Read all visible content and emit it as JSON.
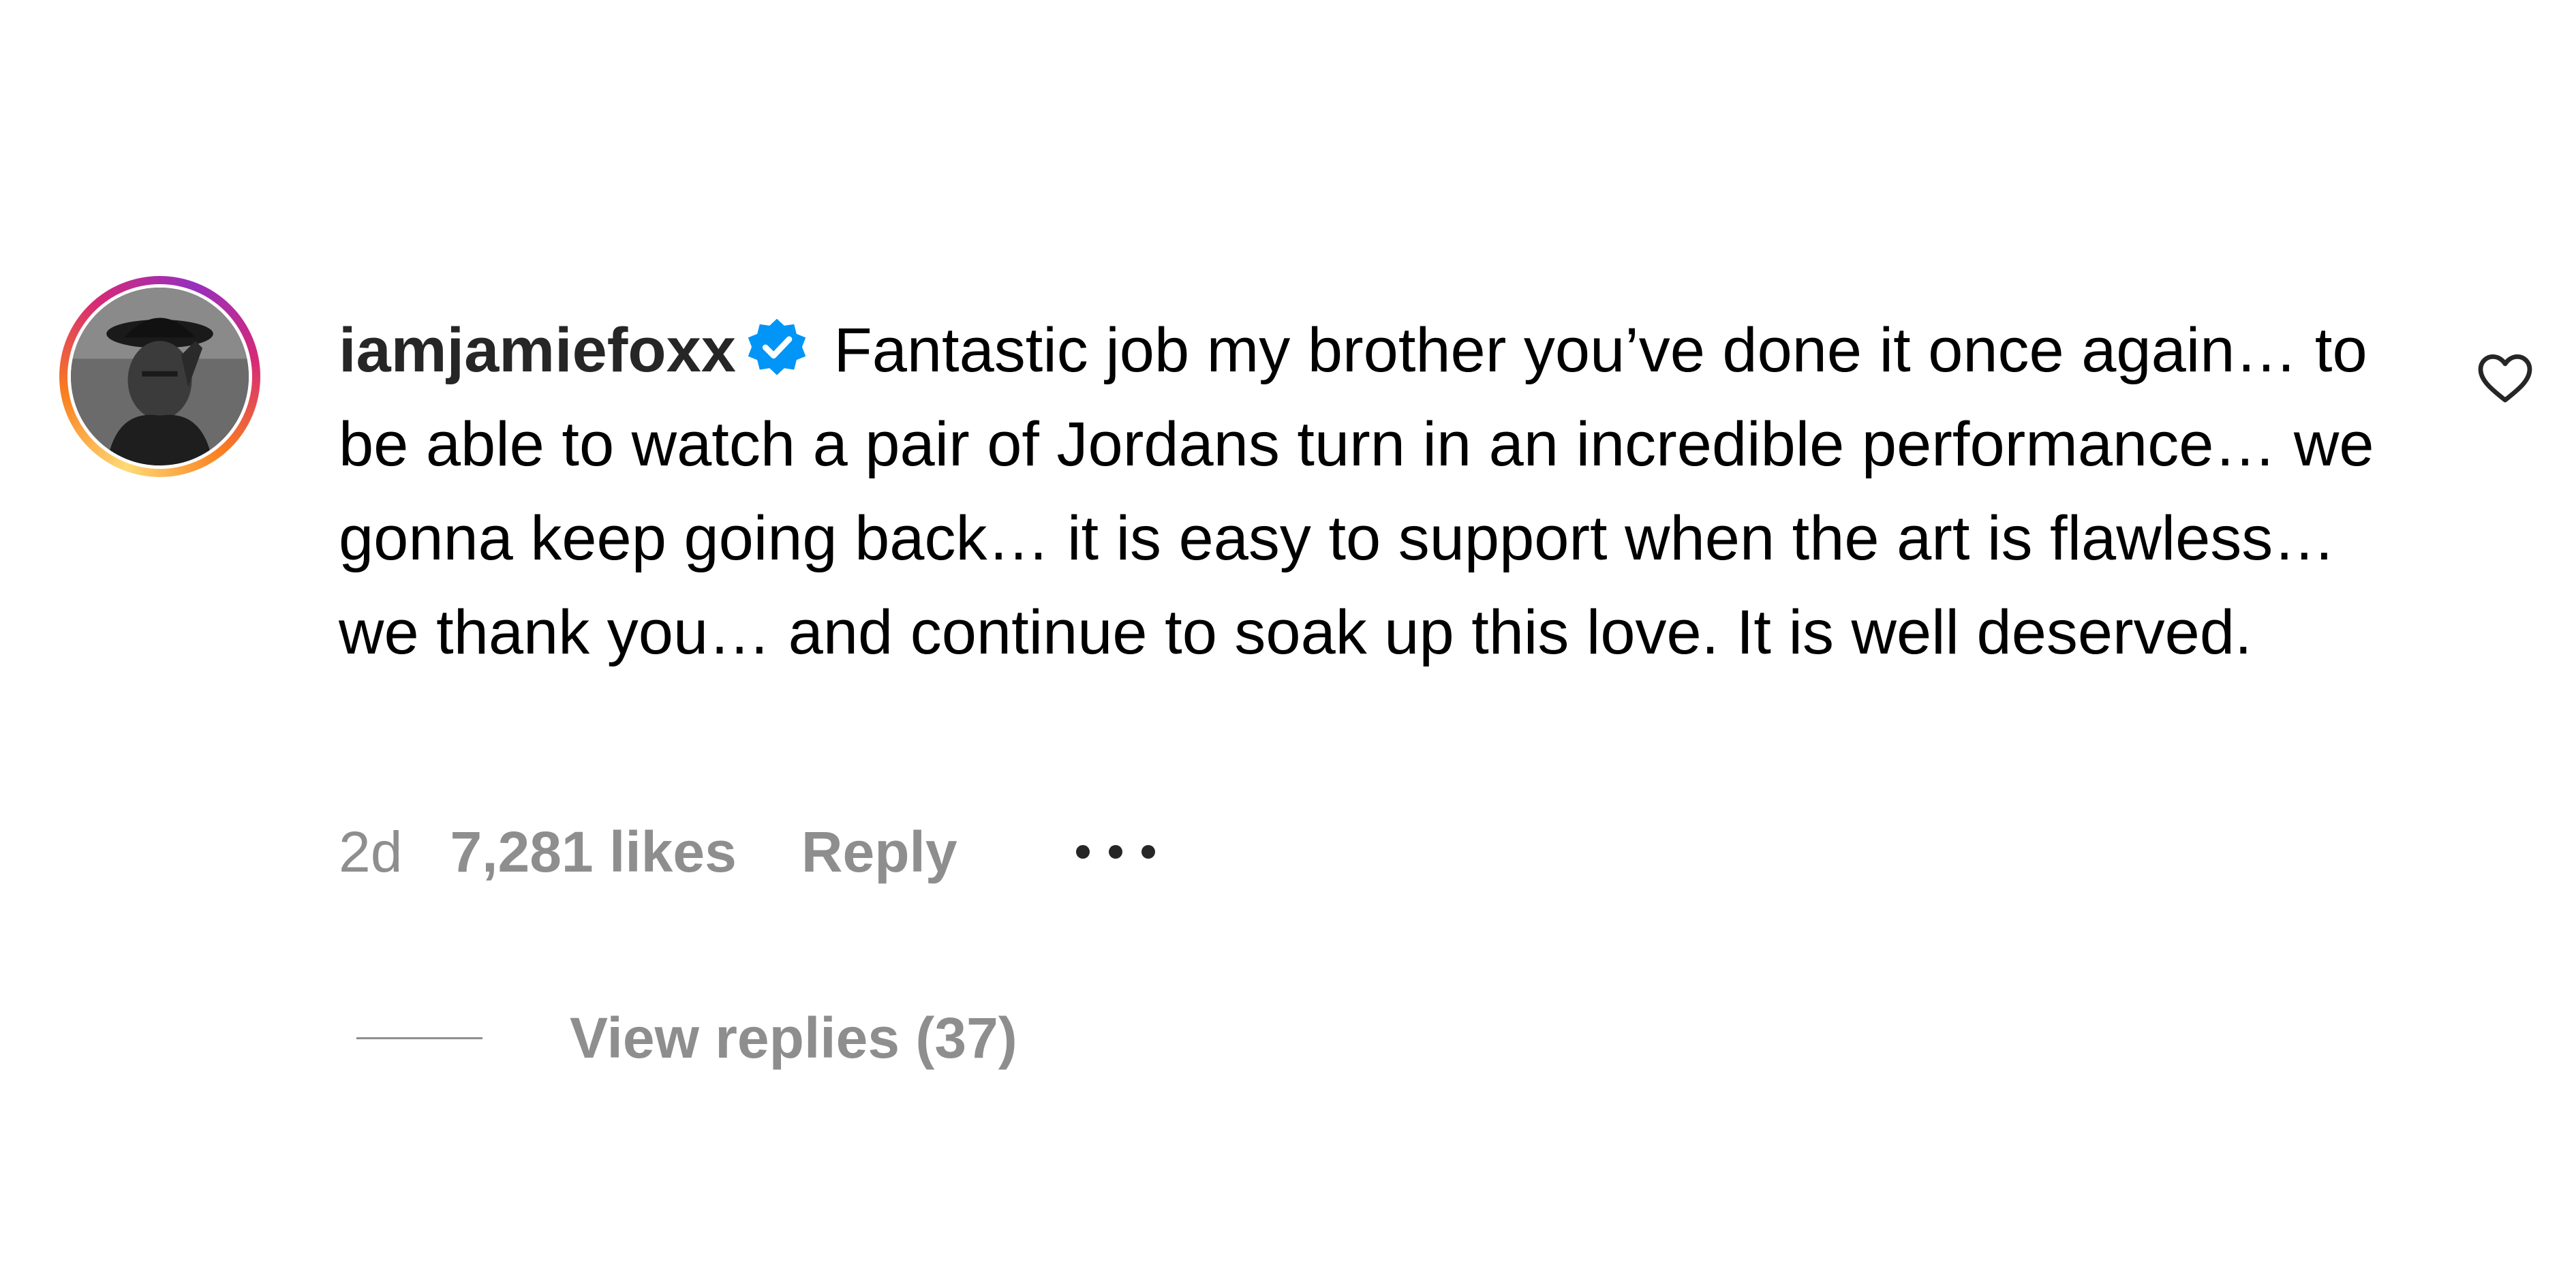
{
  "comment": {
    "username": "iamjamiefoxx",
    "verified_icon": "verified-badge-icon",
    "text": "Fantastic job my brother you’ve done it once again… to be able to watch a pair of Jordans turn in an incredible performance… we gonna keep going back… it is easy to support when the art is flawless… we thank you… and continue to soak up this love. It is well deserved.",
    "time": "2d",
    "likes": "7,281 likes",
    "reply_label": "Reply",
    "more_icon": "more-options-icon",
    "like_icon": "heart-icon",
    "view_replies_label": "View replies (37)"
  },
  "colors": {
    "verified_blue": "#0095f6",
    "meta_gray": "#8e8e8e",
    "text": "#000000"
  }
}
